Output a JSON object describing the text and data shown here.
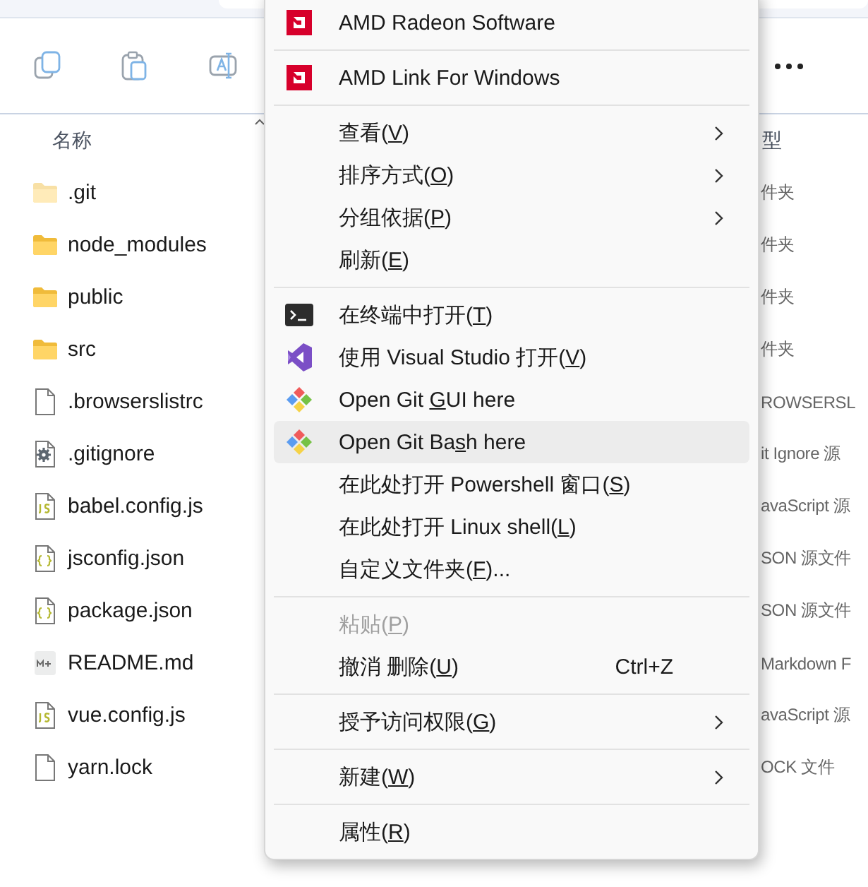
{
  "toolbar": {
    "buttons": [
      {
        "kind": "copy"
      },
      {
        "kind": "paste"
      },
      {
        "kind": "rename"
      }
    ]
  },
  "file_list": {
    "columns": [
      {
        "label": "名称"
      },
      {
        "label": "型"
      }
    ],
    "rows": [
      {
        "name": ".git",
        "kind": "folder",
        "hidden": true,
        "type": "件夹"
      },
      {
        "name": "node_modules",
        "kind": "folder",
        "hidden": false,
        "type": "件夹"
      },
      {
        "name": "public",
        "kind": "folder",
        "hidden": false,
        "type": "件夹"
      },
      {
        "name": "src",
        "kind": "folder",
        "hidden": false,
        "type": "件夹"
      },
      {
        "name": ".browserslistrc",
        "kind": "file",
        "hidden": false,
        "type": "ROWSERSL"
      },
      {
        "name": ".gitignore",
        "kind": "gear",
        "hidden": false,
        "type": "it Ignore 源"
      },
      {
        "name": "babel.config.js",
        "kind": "js",
        "hidden": false,
        "type": "avaScript 源"
      },
      {
        "name": "jsconfig.json",
        "kind": "json",
        "hidden": false,
        "type": "SON 源文件"
      },
      {
        "name": "package.json",
        "kind": "json",
        "hidden": false,
        "type": "SON 源文件"
      },
      {
        "name": "README.md",
        "kind": "md",
        "hidden": false,
        "type": "Markdown F"
      },
      {
        "name": "vue.config.js",
        "kind": "js",
        "hidden": false,
        "type": "avaScript 源"
      },
      {
        "name": "yarn.lock",
        "kind": "file",
        "hidden": false,
        "type": "OCK 文件"
      }
    ]
  },
  "context_menu": {
    "items": [
      {
        "kind": "amd",
        "before": "AMD Radeon Software",
        "submenu": false,
        "disabled": false,
        "selected": false
      },
      {
        "kind": "separator"
      },
      {
        "kind": "amd",
        "before": "AMD Link For Windows",
        "submenu": false,
        "disabled": false,
        "selected": false
      },
      {
        "kind": "separator"
      },
      {
        "kind": "plain",
        "before": "查看(",
        "key": "V",
        "after": ")",
        "submenu": true,
        "disabled": false,
        "selected": false
      },
      {
        "kind": "plain",
        "before": "排序方式(",
        "key": "O",
        "after": ")",
        "submenu": true,
        "disabled": false,
        "selected": false
      },
      {
        "kind": "plain",
        "before": "分组依据(",
        "key": "P",
        "after": ")",
        "submenu": true,
        "disabled": false,
        "selected": false
      },
      {
        "kind": "plain",
        "before": "刷新(",
        "key": "E",
        "after": ")",
        "submenu": false,
        "disabled": false,
        "selected": false
      },
      {
        "kind": "separator"
      },
      {
        "kind": "terminal",
        "before": "在终端中打开(",
        "key": "T",
        "after": ")",
        "submenu": false,
        "disabled": false,
        "selected": false
      },
      {
        "kind": "vs",
        "before": "使用 Visual Studio 打开(",
        "key": "V",
        "after": ")",
        "submenu": false,
        "disabled": false,
        "selected": false
      },
      {
        "kind": "git",
        "before": "Open Git ",
        "key": "G",
        "after": "UI here",
        "submenu": false,
        "disabled": false,
        "selected": false
      },
      {
        "kind": "git",
        "before": "Open Git Ba",
        "key": "s",
        "after": "h here",
        "submenu": false,
        "disabled": false,
        "selected": true
      },
      {
        "kind": "plain",
        "before": "在此处打开 Powershell 窗口(",
        "key": "S",
        "after": ")",
        "submenu": false,
        "disabled": false,
        "selected": false
      },
      {
        "kind": "plain",
        "before": "在此处打开 Linux shell(",
        "key": "L",
        "after": ")",
        "submenu": false,
        "disabled": false,
        "selected": false
      },
      {
        "kind": "plain",
        "before": "自定义文件夹(",
        "key": "F",
        "after": ")...",
        "submenu": false,
        "disabled": false,
        "selected": false
      },
      {
        "kind": "separator"
      },
      {
        "kind": "plain",
        "before": "粘贴(",
        "key": "P",
        "after": ")",
        "submenu": false,
        "disabled": true,
        "selected": false
      },
      {
        "kind": "plain",
        "before": "撤消 删除(",
        "key": "U",
        "after": ")",
        "shortcut": "Ctrl+Z",
        "submenu": false,
        "disabled": false,
        "selected": false
      },
      {
        "kind": "separator"
      },
      {
        "kind": "plain",
        "before": "授予访问权限(",
        "key": "G",
        "after": ")",
        "submenu": true,
        "disabled": false,
        "selected": false
      },
      {
        "kind": "separator"
      },
      {
        "kind": "plain",
        "before": "新建(",
        "key": "W",
        "after": ")",
        "submenu": true,
        "disabled": false,
        "selected": false
      },
      {
        "kind": "separator"
      },
      {
        "kind": "plain",
        "before": "属性(",
        "key": "R",
        "after": ")",
        "submenu": false,
        "disabled": false,
        "selected": false
      }
    ]
  }
}
